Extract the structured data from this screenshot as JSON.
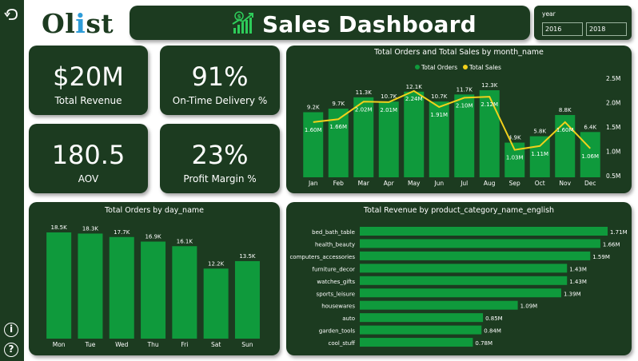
{
  "nav": {
    "back_icon": "back-arrow-icon",
    "info_icon": "info-icon",
    "help_icon": "help-icon"
  },
  "logo": {
    "part1": "Ol",
    "part2": "i",
    "part3": "st"
  },
  "header": {
    "title": "Sales Dashboard",
    "icon": "growth-chart-money-icon"
  },
  "slicer": {
    "label": "year",
    "from": "2016",
    "to": "2018"
  },
  "kpis": [
    {
      "value": "$20M",
      "label": "Total Revenue"
    },
    {
      "value": "91%",
      "label": "On-Time Delivery %"
    },
    {
      "value": "180.5",
      "label": "AOV"
    },
    {
      "value": "23%",
      "label": "Profit Margin %"
    }
  ],
  "colors": {
    "panel": "#1c3b20",
    "bar": "#0f9a3c",
    "line": "#f2d11b",
    "accent_i": "#2e9cd8",
    "logo_green": "#1c3b20"
  },
  "chart_data": [
    {
      "type": "bar",
      "title": "Total Orders and Total Sales by month_name",
      "legend": [
        "Total Orders",
        "Total Sales"
      ],
      "legend_position": "top-center",
      "categories": [
        "Jan",
        "Feb",
        "Mar",
        "Apr",
        "May",
        "Jun",
        "Jul",
        "Aug",
        "Sep",
        "Oct",
        "Nov",
        "Dec"
      ],
      "series": [
        {
          "name": "Total Orders",
          "type": "bar",
          "values": [
            9.2,
            9.7,
            11.3,
            10.7,
            12.1,
            10.7,
            11.7,
            12.3,
            4.9,
            5.8,
            8.8,
            6.4
          ],
          "labels": [
            "9.2K",
            "9.7K",
            "11.3K",
            "10.7K",
            "12.1K",
            "10.7K",
            "11.7K",
            "12.3K",
            "4.9K",
            "5.8K",
            "8.8K",
            "6.4K"
          ]
        },
        {
          "name": "Total Sales",
          "type": "line",
          "values": [
            1.6,
            1.66,
            2.02,
            2.01,
            2.24,
            1.91,
            2.1,
            2.12,
            1.03,
            1.11,
            1.6,
            1.06
          ],
          "labels": [
            "1.60M",
            "1.66M",
            "2.02M",
            "2.01M",
            "2.24M",
            "1.91M",
            "2.10M",
            "2.12M",
            "1.03M",
            "1.11M",
            "1.60M",
            "1.06M"
          ]
        }
      ],
      "y2_ticks": [
        "2.5M",
        "2.0M",
        "1.5M",
        "1.0M",
        "0.5M"
      ],
      "y2lim": [
        0.5,
        2.5
      ]
    },
    {
      "type": "bar",
      "title": "Total Orders by day_name",
      "categories": [
        "Mon",
        "Tue",
        "Wed",
        "Thu",
        "Fri",
        "Sat",
        "Sun"
      ],
      "values": [
        18.5,
        18.3,
        17.7,
        16.9,
        16.1,
        12.2,
        13.5
      ],
      "labels": [
        "18.5K",
        "18.3K",
        "17.7K",
        "16.9K",
        "16.1K",
        "12.2K",
        "13.5K"
      ]
    },
    {
      "type": "bar",
      "orientation": "horizontal",
      "title": "Total Revenue by product_category_name_english",
      "categories": [
        "bed_bath_table",
        "health_beauty",
        "computers_accessories",
        "furniture_decor",
        "watches_gifts",
        "sports_leisure",
        "housewares",
        "auto",
        "garden_tools",
        "cool_stuff"
      ],
      "values": [
        1.71,
        1.66,
        1.59,
        1.43,
        1.43,
        1.39,
        1.09,
        0.85,
        0.84,
        0.78
      ],
      "labels": [
        "1.71M",
        "1.66M",
        "1.59M",
        "1.43M",
        "1.43M",
        "1.39M",
        "1.09M",
        "0.85M",
        "0.84M",
        "0.78M"
      ]
    }
  ]
}
